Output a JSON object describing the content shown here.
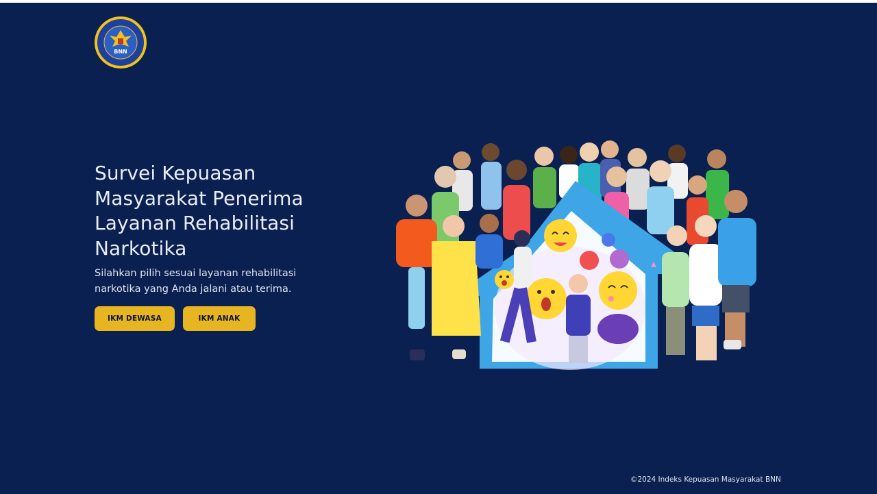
{
  "brand": {
    "logo_text": "BNN",
    "logo_ring_text": "BADAN NARKOTIKA NASIONAL",
    "logo_bottom_text": "REPUBLIK INDONESIA"
  },
  "hero": {
    "title": "Survei Kepuasan Masyarakat Penerima Layanan Rehabilitasi Narkotika",
    "subtitle": "Silahkan pilih sesuai layanan rehabilitasi narkotika yang Anda jalani atau terima."
  },
  "buttons": {
    "dewasa_label": "IKM DEWASA",
    "anak_label": "IKM ANAK"
  },
  "footer": {
    "copyright": "©2024  Indeks Kepuasan Masyarakat BNN"
  },
  "colors": {
    "background": "#0a2050",
    "button": "#e7b522",
    "house": "#3ea6e6"
  }
}
